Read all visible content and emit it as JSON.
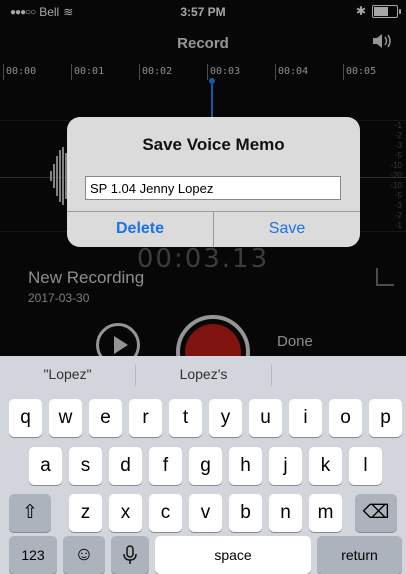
{
  "status_bar": {
    "signal": "●●●○○",
    "carrier": "Bell",
    "wifi": "≋",
    "time": "3:57 PM",
    "bluetooth": "✱"
  },
  "nav": {
    "title": "Record"
  },
  "timeline": {
    "ticks": [
      "00:00",
      "00:01",
      "00:02",
      "00:03",
      "00:04",
      "00:05"
    ]
  },
  "waveform": {
    "db_labels": [
      "-1",
      "-2",
      "-3",
      "-5",
      "-10",
      "-20",
      "-10",
      "-5",
      "-3",
      "-2",
      "-1"
    ]
  },
  "recording": {
    "timer": "00:03.13",
    "name": "New Recording",
    "date": "2017-03-30",
    "done_label": "Done"
  },
  "dialog": {
    "title": "Save Voice Memo",
    "input_value": "SP 1.04 Jenny Lopez",
    "delete_label": "Delete",
    "save_label": "Save"
  },
  "keyboard": {
    "suggestions": [
      "\"Lopez\"",
      "Lopez's",
      ""
    ],
    "row1": [
      "q",
      "w",
      "e",
      "r",
      "t",
      "y",
      "u",
      "i",
      "o",
      "p"
    ],
    "row2": [
      "a",
      "s",
      "d",
      "f",
      "g",
      "h",
      "j",
      "k",
      "l"
    ],
    "row3": [
      "z",
      "x",
      "c",
      "v",
      "b",
      "n",
      "m"
    ],
    "shift_glyph": "⇧",
    "backspace_glyph": "⌫",
    "numbers_label": "123",
    "emoji_glyph": "☺",
    "mic_glyph": "🎙",
    "space_label": "space",
    "return_label": "return"
  },
  "colors": {
    "record_red": "#c41e1a",
    "accent_blue": "#1a73e8"
  }
}
